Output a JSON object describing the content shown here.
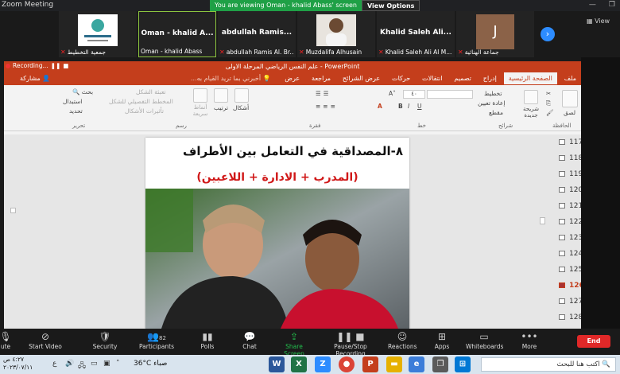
{
  "zoom": {
    "window_title": "Zoom Meeting",
    "banner_text": "You are viewing Oman - khalid Abass' screen",
    "view_options": "View Options",
    "view_label": "View",
    "participants": [
      {
        "name": "جمعية التخطيط",
        "logo_text": "",
        "big_name": ""
      },
      {
        "name": "Oman - khalid Abass",
        "big_name": "Oman - khalid A...",
        "active": true
      },
      {
        "name": "abdullah Ramis Al. Br...",
        "big_name": "abdullah Ramis..."
      },
      {
        "name": "Muzdalifa Alhusain",
        "big_name": ""
      },
      {
        "name": "Khalid Saleh Ali Al M...",
        "big_name": "Khalid Saleh Ali..."
      },
      {
        "name": "جماعة الهنائية",
        "avatar_letter": "J",
        "big_name": ""
      }
    ],
    "toolbar": [
      {
        "label": "ute",
        "icon": "mic-icon"
      },
      {
        "label": "Start Video",
        "icon": "video-off-icon"
      },
      {
        "label": "Security",
        "icon": "shield-icon"
      },
      {
        "label": "Participants",
        "icon": "participants-icon",
        "count": "82"
      },
      {
        "label": "Polls",
        "icon": "polls-icon"
      },
      {
        "label": "Chat",
        "icon": "chat-icon"
      },
      {
        "label": "Share Screen",
        "icon": "share-screen-icon"
      },
      {
        "label": "Pause/Stop Recording",
        "icon": "pause-stop-icon"
      },
      {
        "label": "Reactions",
        "icon": "reactions-icon"
      },
      {
        "label": "Apps",
        "icon": "apps-icon"
      },
      {
        "label": "Whiteboards",
        "icon": "whiteboard-icon"
      },
      {
        "label": "More",
        "icon": "more-icon"
      }
    ],
    "end_label": "End"
  },
  "ppt": {
    "recording_label": "Recording...",
    "doc_title": "علم النفس الرياضي المرحلة الاولى - PowerPoint",
    "tabs": [
      "ملف",
      "الصفحة الرئيسية",
      "إدراج",
      "تصميم",
      "انتقالات",
      "حركات",
      "عرض الشرائح",
      "مراجعة",
      "عرض"
    ],
    "tell_me": "أخبرني بما تريد القيام به...",
    "share": "مشاركة",
    "ribbon": {
      "paste": "لصق",
      "clipboard": "الحافظة",
      "new_slide": "شريحة جديدة",
      "layout": "تخطيط",
      "reset": "إعادة تعيين",
      "section": "مقطع",
      "slides": "شرائح",
      "font_group": "خط",
      "paragraph_group": "فقرة",
      "font_size": "٤٠",
      "shapes": "أشكال",
      "arrange": "ترتيب",
      "quick_styles": "أنماط سريعة",
      "shape_fill": "تعبئة الشكل",
      "shape_outline": "المخطط التفصيلي للشكل",
      "shape_effects": "تأثيرات الأشكال",
      "drawing_group": "رسم",
      "find": "بحث",
      "replace": "استبدال",
      "select": "تحديد",
      "editing_group": "تحرير"
    },
    "slide": {
      "title": "٨-المصداقية في التعامل بين الأطراف",
      "subtitle": "(المدرب + الادارة + اللاعبين)"
    },
    "thumbnails": [
      "117",
      "118",
      "119",
      "120",
      "121",
      "122",
      "123",
      "124",
      "125",
      "126",
      "127",
      "128"
    ],
    "selected_slide": "126"
  },
  "taskbar": {
    "time": "٤:٢٧ ص",
    "date": "٢٠٢٣/٠٧/١١",
    "day": "ع",
    "weather": "36°C  صباء",
    "search_placeholder": "اكتب هنا للبحث"
  }
}
